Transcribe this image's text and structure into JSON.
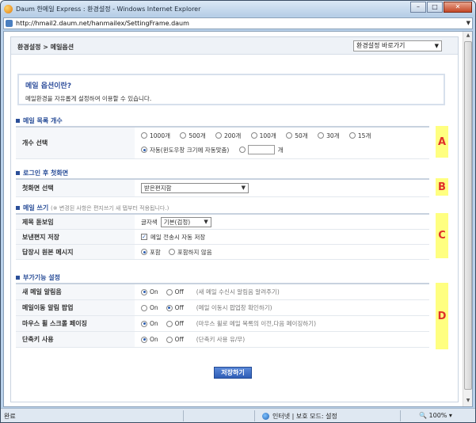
{
  "window": {
    "title": "Daum 한메일 Express : 환경설정 - Windows Internet Explorer",
    "url": "http://hmail2.daum.net/hanmailex/SettingFrame.daum"
  },
  "header": {
    "breadcrumb": "환경설정 > 메일옵션",
    "quickjump": "환경설정 바로가기"
  },
  "intro": {
    "heading": "메일 옵션이란?",
    "desc": "메일환경을 자유롭게 설정하여 이용할 수 있습니다."
  },
  "sections": {
    "list_count": {
      "title": "메일 목록 개수",
      "label": "개수 선택",
      "options": [
        "1000개",
        "500개",
        "200개",
        "100개",
        "50개",
        "30개",
        "15개"
      ],
      "auto_label": "자동(윈도우창 크기에 자동맞춤)",
      "unit": "개",
      "marker": "A"
    },
    "first_screen": {
      "title": "로그인 후 첫화면",
      "label": "첫화면 선택",
      "selected": "받은편지함",
      "marker": "B"
    },
    "compose": {
      "title": "메일 쓰기",
      "note": "(※ 변경된 사항은 편지쓰기 새 탭부터 적용됩니다.)",
      "rows": [
        {
          "label": "제목 돋보임",
          "prefix": "글자색",
          "value": "기본(검정)"
        },
        {
          "label": "보낸편지 저장",
          "value": "메일 전송시 자동 저장"
        },
        {
          "label": "답장시 원본 메시지",
          "opt1": "포함",
          "opt2": "포함하지 않음"
        }
      ],
      "marker": "C"
    },
    "extra": {
      "title": "부가기능 설정",
      "rows": [
        {
          "label": "새 메일 알림음",
          "on": "On",
          "off": "Off",
          "hint": "(새 메일 수신시 알림음 알려주기)"
        },
        {
          "label": "메일이동 알림 팝업",
          "on": "On",
          "off": "Off",
          "hint": "(메일 이동시 팝업창 확인하기)"
        },
        {
          "label": "마우스 휠 스크롤 페이징",
          "on": "On",
          "off": "Off",
          "hint": "(마우스 휠로 메일 목록의 이전,다음 페이징하기)"
        },
        {
          "label": "단축키 사용",
          "on": "On",
          "off": "Off",
          "hint": "(단축키 사용 유/무)"
        }
      ],
      "marker": "D"
    }
  },
  "save_label": "저장하기",
  "status": {
    "left": "완료",
    "zone": "인터넷 | 보호 모드: 설정",
    "zoom": "100%"
  },
  "colors": {
    "accent": "#2b4f99",
    "marker_bg": "#ffff80",
    "marker_fg": "#e0302a"
  }
}
